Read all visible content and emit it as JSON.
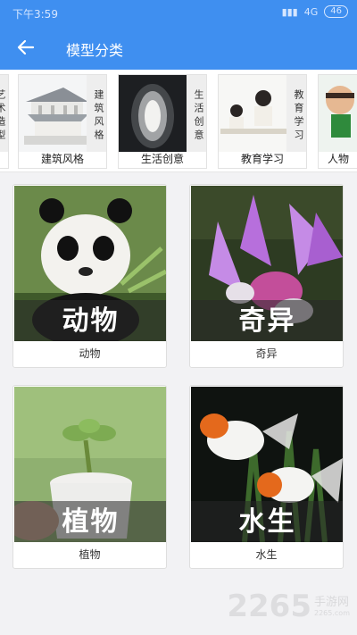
{
  "status": {
    "time": "下午3:59",
    "network": "4G",
    "battery": "46"
  },
  "header": {
    "title": "模型分类",
    "back_icon": "arrow-left-icon",
    "bg_color": "#3f8ff0"
  },
  "categories": [
    {
      "label": "",
      "vertical": "艺术造型"
    },
    {
      "label": "建筑风格",
      "vertical": "建筑风格"
    },
    {
      "label": "生活创意",
      "vertical": "生活创意"
    },
    {
      "label": "教育学习",
      "vertical": "教育学习"
    },
    {
      "label": "人物",
      "vertical": ""
    }
  ],
  "cards": [
    {
      "big": "动物",
      "caption": "动物"
    },
    {
      "big": "奇异",
      "caption": "奇异"
    },
    {
      "big": "植物",
      "caption": "植物"
    },
    {
      "big": "水生",
      "caption": "水生"
    }
  ],
  "watermark": {
    "brand": "2265",
    "site_name": "手游网",
    "url": "2265.com"
  }
}
